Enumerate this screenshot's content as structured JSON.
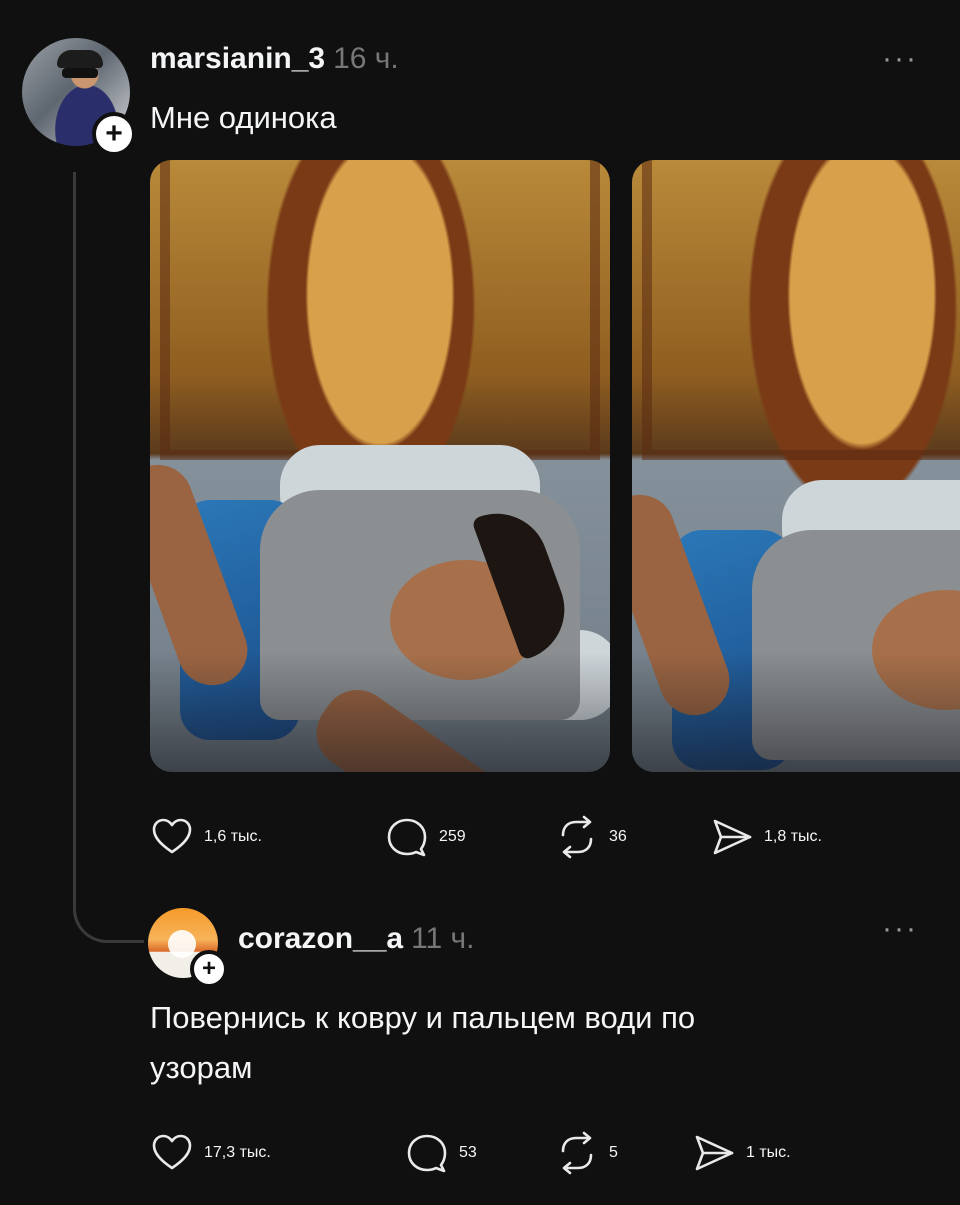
{
  "post": {
    "username": "marsianin_3",
    "time": "16 ч.",
    "text": "Мне одинока",
    "more_label": "···",
    "avatar_badge": "+",
    "photos_count_visible": 2,
    "actions": {
      "likes": "1,6 тыс.",
      "comments": "259",
      "reposts": "36",
      "shares": "1,8 тыс."
    }
  },
  "reply": {
    "username": "corazon__a",
    "time": "11 ч.",
    "text_line1": "Повернись к ковру и пальцем води по",
    "text_line2": "узорам",
    "more_label": "···",
    "avatar_badge": "+",
    "actions": {
      "likes": "17,3 тыс.",
      "comments": "53",
      "reposts": "5",
      "shares": "1 тыс."
    }
  },
  "icons": {
    "like": "heart-icon",
    "comment": "comment-bubble-icon",
    "repost": "repost-icon",
    "share": "send-icon"
  },
  "colors": {
    "background": "#101010",
    "text": "#f3f5f7",
    "muted": "#777777",
    "thread_line": "#3a3a3a"
  }
}
